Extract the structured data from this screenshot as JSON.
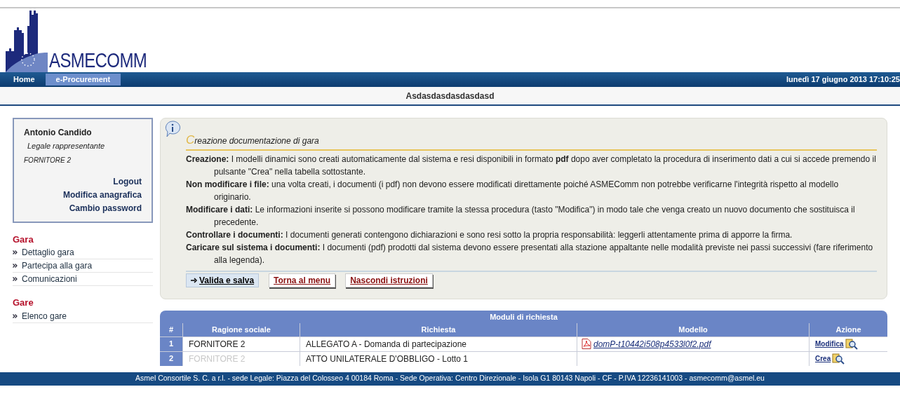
{
  "logo": {
    "text": "ASMECOMM"
  },
  "nav": {
    "items": [
      {
        "label": "Home",
        "selected": false
      },
      {
        "label": "e-Procurement",
        "selected": true
      }
    ],
    "date": "lunedì 17 giugno 2013 17:10:25"
  },
  "page_title": "Asdasdasdasdasdasd",
  "user_box": {
    "name": "Antonio Candido",
    "role": "Legale rappresentante",
    "company": "FORNITORE 2",
    "links": [
      "Logout",
      "Modifica anagrafica",
      "Cambio password"
    ]
  },
  "sidebar": [
    {
      "title": "Gara",
      "items": [
        "Dettaglio gara",
        "Partecipa alla gara",
        "Comunicazioni"
      ]
    },
    {
      "title": "Gare",
      "items": [
        "Elenco gare"
      ]
    }
  ],
  "instructions": {
    "title_initial": "C",
    "title_rest": "reazione documentazione di gara",
    "paragraphs": [
      "**Creazione:**  I modelli dinamici sono creati automaticamente dal sistema e resi disponibili in formato **pdf** dopo aver completato la procedura di inserimento dati a cui si accede premendo il pulsante \"Crea\" nella tabella sottostante.",
      "**Non modificare i file:**  una volta creati, i documenti (i pdf) non devono essere modificati direttamente poiché ASMEComm non potrebbe verificarne l'integrità rispetto al modello originario.",
      "**Modificare i dati:**  Le informazioni inserite si possono modificare tramite la stessa procedura (tasto \"Modifica\") in modo tale che venga creato un nuovo documento che sostituisca il precedente.",
      "**Controllare i documenti:**  I documenti generati contengono dichiarazioni e sono resi sotto la propria responsabilità: leggerli attentamente prima di apporre la firma.",
      "**Caricare sul sistema i documenti:**  I documenti (pdf) prodotti dal sistema devono essere presentati alla stazione appaltante nelle modalità previste nei passi successivi (fare riferimento alla legenda)."
    ],
    "buttons": [
      {
        "label": "Valida e salva",
        "kind": "primary"
      },
      {
        "label": "Torna al menu",
        "kind": "secondary"
      },
      {
        "label": "Nascondi istruzioni",
        "kind": "secondary"
      }
    ]
  },
  "table": {
    "title": "Moduli di richiesta",
    "columns": [
      "#",
      "Ragione sociale",
      "Richiesta",
      "Modello",
      "Azione"
    ],
    "rows": [
      {
        "index": "1",
        "company": "FORNITORE 2",
        "greyed": false,
        "request": "ALLEGATO A - Domanda di partecipazione",
        "file": "domP-t10442i508p4533l0f2.pdf",
        "action": "Modifica"
      },
      {
        "index": "2",
        "company": "FORNITORE 2",
        "greyed": true,
        "request": "ATTO UNILATERALE D'OBBLIGO - Lotto 1",
        "action": "Crea"
      }
    ]
  },
  "footer": "Asmel Consortile S. C. a r.l. - sede Legale: Piazza del Colosseo 4 00184 Roma - Sede Operativa: Centro Direzionale - Isola G1 80143 Napoli - CF - P.IVA 12236141003 - asmecomm@asmel.eu"
}
